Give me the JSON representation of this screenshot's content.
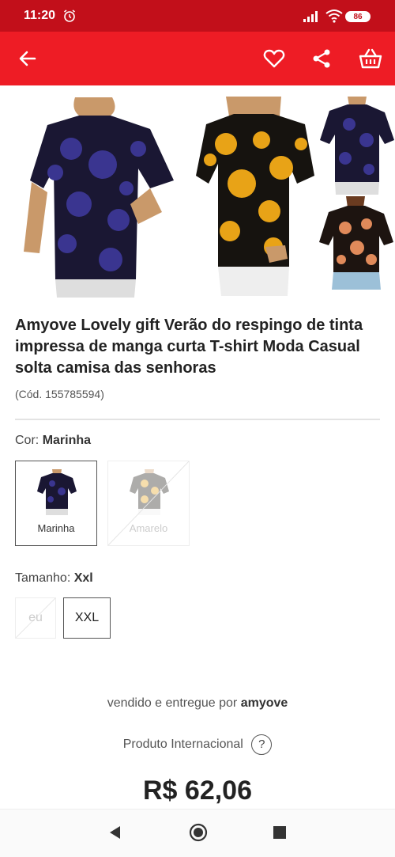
{
  "status_bar": {
    "time": "11:20",
    "battery": "86"
  },
  "app_bar": {
    "back": "back",
    "favorite": "favorite",
    "share": "share",
    "cart": "basket"
  },
  "product": {
    "title": "Amyove Lovely gift Verão do respingo de tinta impressa de manga curta T-shirt Moda Casual solta camisa das senhoras",
    "code": "(Cód. 155785594)"
  },
  "color": {
    "label": "Cor:",
    "selected": "Marinha",
    "options": [
      {
        "label": "Marinha",
        "available": true,
        "selected": true
      },
      {
        "label": "Amarelo",
        "available": false,
        "selected": false
      }
    ]
  },
  "size": {
    "label": "Tamanho:",
    "selected": "Xxl",
    "options": [
      {
        "label": "eu",
        "available": false,
        "selected": false
      },
      {
        "label": "XXL",
        "available": true,
        "selected": true
      }
    ]
  },
  "seller": {
    "prefix": "vendido e entregue por",
    "name": "amyove"
  },
  "international": {
    "label": "Produto Internacional",
    "help": "?"
  },
  "price": "R$ 62,06",
  "colors": {
    "brand_red": "#ee1c25",
    "status_red": "#c20f1a",
    "navy": "#2c2a6b",
    "yellow": "#e8a317"
  }
}
